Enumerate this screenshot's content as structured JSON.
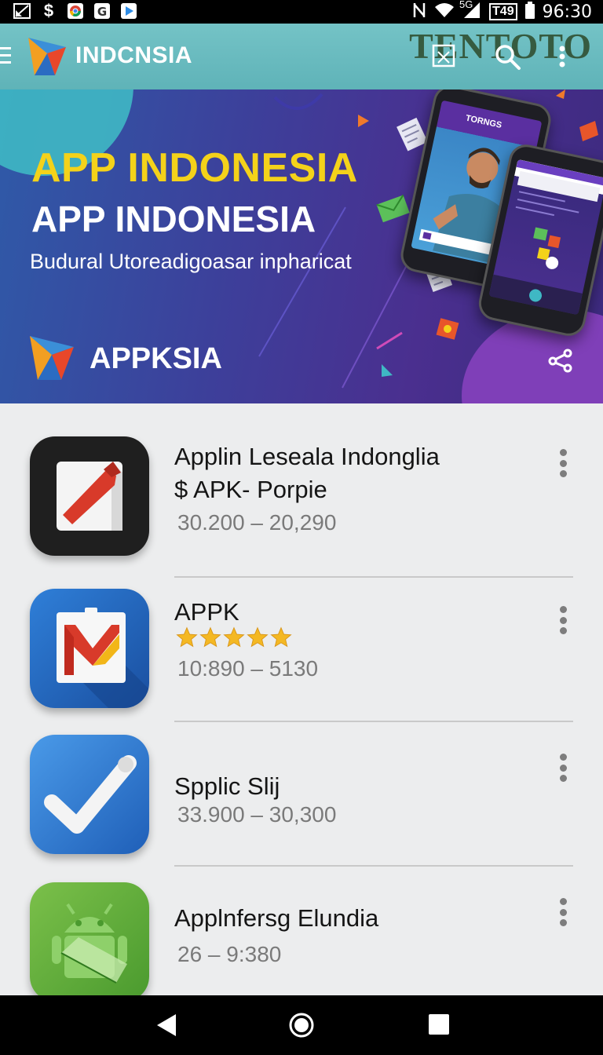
{
  "status_bar": {
    "left_icons": [
      "image-icon",
      "dollar-icon",
      "chrome-icon",
      "g-icon",
      "play-store-icon"
    ],
    "right_icons": [
      "nfc-icon",
      "wifi-icon",
      "signal-icon",
      "t49-icon"
    ],
    "signal_label": "5G",
    "t49_label": "T49",
    "time": "96:30"
  },
  "app_bar": {
    "title": "INDCNSIA",
    "watermark": "TENTOTO",
    "actions": [
      "gallery-icon",
      "search-icon",
      "more-vert-icon"
    ],
    "color": "#66b8bd"
  },
  "banner": {
    "headline": "APP INDONESIA",
    "headline2": "APP INDONESIA",
    "subtitle": "Budural Utoreadigoasar inpharicat",
    "brand": "APPKSIA",
    "phone_label": "TORNGS",
    "headline_color": "#f4d21a"
  },
  "apps": [
    {
      "title": "Applin Leseala Indonglia",
      "subtitle": "$ APK- Porpie",
      "meta": "30.200 – 20,290",
      "icon": "red-slash-icon"
    },
    {
      "title": "APPK",
      "rating": 5,
      "meta": "10:890 – 5130",
      "icon": "gmail-like-icon"
    },
    {
      "title": "Spplic Slij",
      "meta": "33.900 – 30,300",
      "icon": "checkmark-icon"
    },
    {
      "title": "Applnfersg Elundia",
      "meta": "26 – 9:380",
      "icon": "android-icon"
    }
  ],
  "nav_bar": {
    "buttons": [
      "back-icon",
      "home-icon",
      "recents-icon"
    ]
  }
}
